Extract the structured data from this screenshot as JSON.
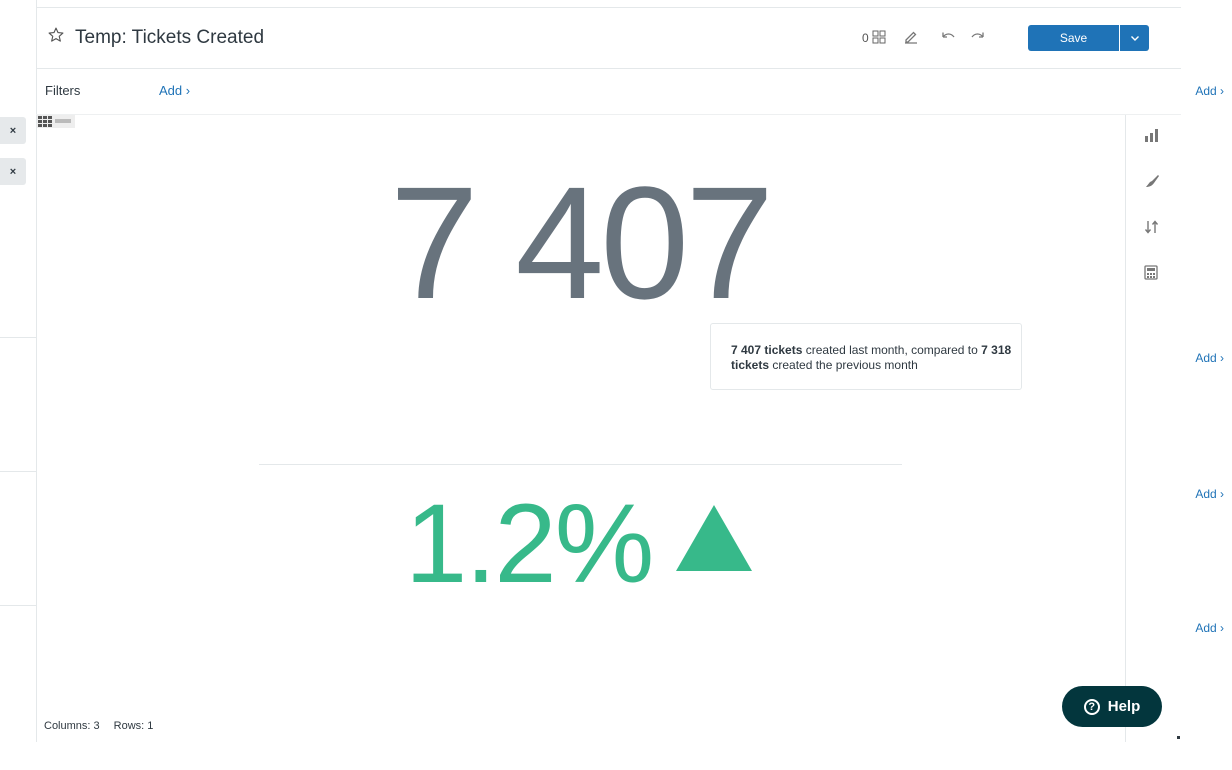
{
  "header": {
    "title": "Temp: Tickets Created",
    "toolbar_counter": "0",
    "save_label": "Save"
  },
  "left_panel": {
    "add_labels": [
      "Add ›",
      "Add ›",
      "Add ›",
      "Add ›"
    ],
    "remove_labels": [
      "×",
      "×"
    ]
  },
  "filters": {
    "label": "Filters",
    "add_label": "Add ›"
  },
  "visual": {
    "main_value": "7 407",
    "tooltip": {
      "value_current": "7 407 tickets",
      "text_middle": " created last month, compared to ",
      "value_previous": "7 318 tickets",
      "text_end": " created the previous month"
    },
    "change_percent": "1.2%",
    "change_direction": "up",
    "change_color": "#37b98a"
  },
  "footer": {
    "columns": "Columns: 3",
    "rows": "Rows: 1"
  },
  "help": {
    "label": "Help",
    "icon_glyph": "?"
  },
  "colors": {
    "accent": "#1f73b7",
    "positive": "#37b98a",
    "value_text": "#68737d",
    "help_bg": "#03363d"
  },
  "icons": {
    "star": "star-icon",
    "layout_toggle": "layout-grid-icon",
    "edit": "edit-pencil-icon",
    "undo": "undo-icon",
    "redo": "redo-icon",
    "caret": "chevron-down-icon",
    "table_toggle": "table-grid-icon",
    "chart_type": "bar-chart-icon",
    "format": "paintbrush-icon",
    "sort": "sort-icon",
    "calculations": "calculator-icon"
  }
}
